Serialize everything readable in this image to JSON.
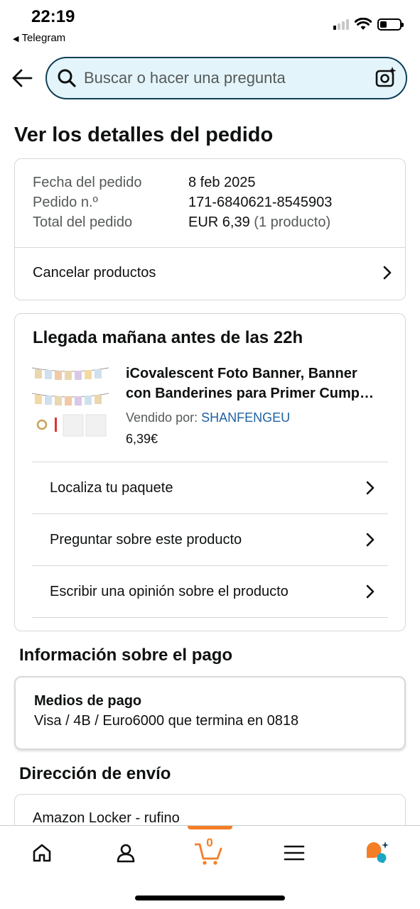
{
  "status_bar": {
    "time": "22:19",
    "back_app": "Telegram"
  },
  "header": {
    "search_placeholder": "Buscar o hacer una pregunta",
    "icons": [
      "back-arrow-icon",
      "search-icon",
      "camera-icon"
    ]
  },
  "page_title": "Ver los detalles del pedido",
  "order_summary": {
    "date_label": "Fecha del pedido",
    "date_value": "8 feb 2025",
    "number_label": "Pedido n.º",
    "number_value": "171-6840621-8545903",
    "total_label": "Total del pedido",
    "total_value": "EUR 6,39",
    "total_items": "(1 producto)",
    "cancel_label": "Cancelar productos"
  },
  "shipment": {
    "title": "Llegada mañana antes de las 22h",
    "product_title_line1": "iCovalescent Foto Banner, Banner",
    "product_title_line2": "con Banderines para Primer Cump…",
    "sold_by_label": "Vendido por:",
    "seller": "SHANFENGEU",
    "price": "6,39€",
    "actions": [
      {
        "label": "Localiza tu paquete"
      },
      {
        "label": "Preguntar sobre este producto"
      },
      {
        "label": "Escribir una opinión sobre el producto"
      }
    ]
  },
  "payment": {
    "section_title": "Información sobre el pago",
    "method_title": "Medios de pago",
    "method_value": "Visa / 4B / Euro6000  que termina en 0818"
  },
  "shipping": {
    "section_title": "Dirección de envío",
    "address_line": "Amazon Locker - rufino"
  },
  "bottom_nav": {
    "cart_count": "0",
    "accent_color": "#f47e26",
    "items": [
      "home-icon",
      "account-icon",
      "cart-icon",
      "menu-icon",
      "rufus-icon"
    ]
  },
  "colors": {
    "search_bg": "#e3f5fb",
    "search_border": "#0f3f57",
    "link": "#2162a1",
    "divider": "#d5d9d9"
  }
}
